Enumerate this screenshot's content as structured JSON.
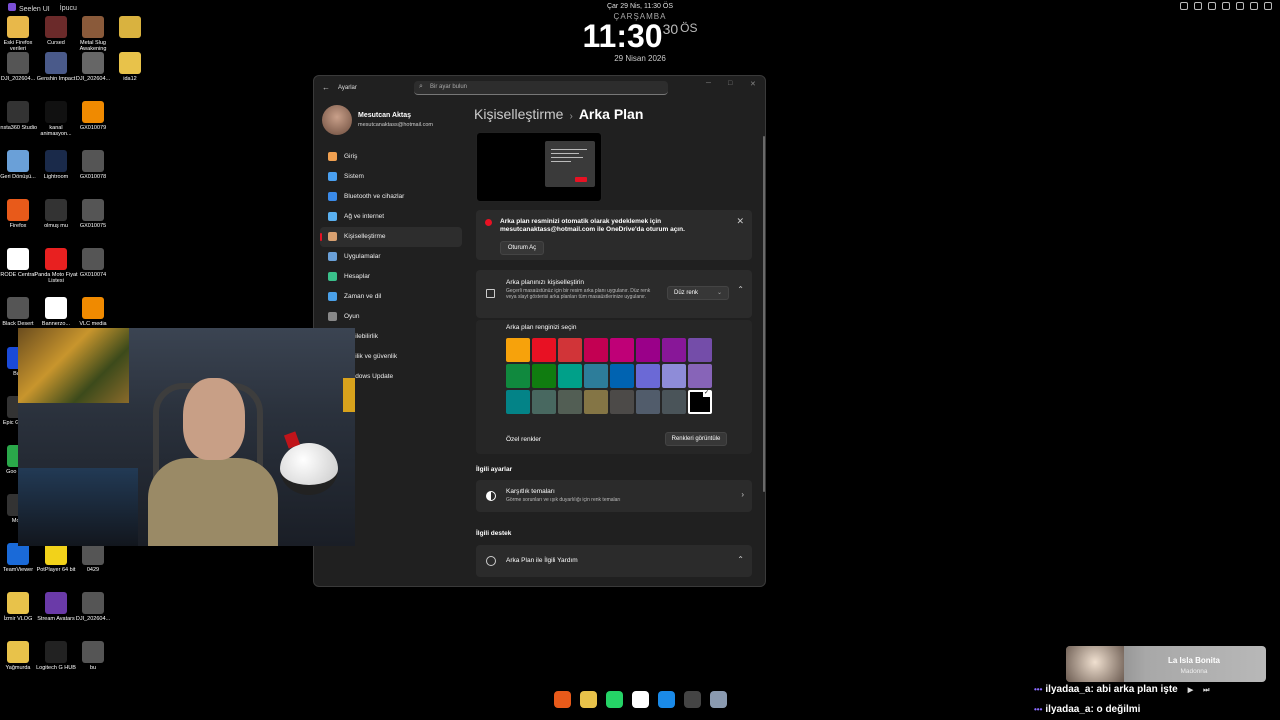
{
  "topbar": {
    "app": "Seelen UI",
    "tip": "İpucu",
    "datetime": "Çar 29 Nis, 11:30 ÖS"
  },
  "clock": {
    "day": "ÇARŞAMBA",
    "time": "11:30",
    "seconds": "30",
    "ampm": "ÖS",
    "date": "29 Nisan 2026"
  },
  "desktop_icons": [
    {
      "label": "Eski Firefox verileri",
      "color": "#e8b84a"
    },
    {
      "label": "Cursed",
      "color": "#6b2a2a"
    },
    {
      "label": "Metal Slug Awakening",
      "color": "#8a5a3a"
    },
    {
      "label": "",
      "color": "#d9b23f"
    },
    {
      "label": "DJI_202604...",
      "color": "#555"
    },
    {
      "label": "Genshin Impact",
      "color": "#4a5a8a"
    },
    {
      "label": "DJI_202604...",
      "color": "#666"
    },
    {
      "label": "ida12",
      "color": "#e8c24a"
    },
    {
      "label": "Insta360 Studio",
      "color": "#333"
    },
    {
      "label": "kanal animasyon...",
      "color": "#111"
    },
    {
      "label": "GX010079",
      "color": "#f08a00"
    },
    {
      "label": "Geri Dönüşü...",
      "color": "#6aa0d8"
    },
    {
      "label": "Lightroom",
      "color": "#1a2a4a"
    },
    {
      "label": "GX010078",
      "color": "#555"
    },
    {
      "label": "Firefox",
      "color": "#e85a1a"
    },
    {
      "label": "olmuş mu",
      "color": "#333"
    },
    {
      "label": "GX010075",
      "color": "#555"
    },
    {
      "label": "RODE Central",
      "color": "#fff"
    },
    {
      "label": "Panda Moto Fiyat Listesi",
      "color": "#e82020"
    },
    {
      "label": "GX010074",
      "color": "#555"
    },
    {
      "label": "Black Desert",
      "color": "#555"
    },
    {
      "label": "Bannerzo...",
      "color": "#fff"
    },
    {
      "label": "VLC media",
      "color": "#f08a00"
    },
    {
      "label": "TeamViewer",
      "color": "#1a6ad8"
    },
    {
      "label": "PotPlayer 64 bit",
      "color": "#f2d21a"
    },
    {
      "label": "0429",
      "color": "#555"
    },
    {
      "label": "İzmir VLOG",
      "color": "#e8c24a"
    },
    {
      "label": "Stream Avatars",
      "color": "#6a3aa8"
    },
    {
      "label": "DJI_202604...",
      "color": "#555"
    },
    {
      "label": "Yağmurda",
      "color": "#e8c24a"
    },
    {
      "label": "Logitech G HUB",
      "color": "#222"
    },
    {
      "label": "bu",
      "color": "#555"
    },
    {
      "label": "Batt",
      "color": "#1a4ad8"
    },
    {
      "label": "Epic G Laun",
      "color": "#333"
    },
    {
      "label": "Goo Chro",
      "color": "#2aa84a"
    },
    {
      "label": "Moto",
      "color": "#333"
    }
  ],
  "settings": {
    "app_title": "Ayarlar",
    "search_placeholder": "Bir ayar bulun",
    "profile": {
      "name": "Mesutcan Aktaş",
      "email": "mesutcanaktass@hotmail.com"
    },
    "nav": [
      {
        "label": "Giriş",
        "color": "#f0a050"
      },
      {
        "label": "Sistem",
        "color": "#4aa0f0"
      },
      {
        "label": "Bluetooth ve cihazlar",
        "color": "#3a8ae8"
      },
      {
        "label": "Ağ ve internet",
        "color": "#5ab0f0"
      },
      {
        "label": "Kişiselleştirme",
        "color": "#d8a070"
      },
      {
        "label": "Uygulamalar",
        "color": "#6aa0d8"
      },
      {
        "label": "Hesaplar",
        "color": "#3ac08a"
      },
      {
        "label": "Zaman ve dil",
        "color": "#4aa0e8"
      },
      {
        "label": "Oyun",
        "color": "#888"
      },
      {
        "label": "Erişilebilirlik",
        "color": "#4a8ae8"
      },
      {
        "label": "Gizlilik ve güvenlik",
        "color": "#888"
      },
      {
        "label": "Windows Update",
        "color": "#3a8ae8"
      }
    ],
    "breadcrumb": {
      "parent": "Kişiselleştirme",
      "separator": "›",
      "current": "Arka Plan"
    },
    "backup": {
      "message": "Arka plan resminizi otomatik olarak yedeklemek için mesutcanaktass@hotmail.com ile OneDrive'da oturum açın.",
      "button": "Oturum Aç"
    },
    "personalize": {
      "title": "Arka planınızı kişiselleştirin",
      "description": "Geçerli masaüstünüz için bir resim arka planı uygulanır. Düz renk veya slayt gösterisi arka planları tüm masaüstlerinize uygulanır.",
      "selected": "Düz renk"
    },
    "color_picker": {
      "label": "Arka plan renginizi seçin",
      "swatches": [
        "#f7a20b",
        "#e81123",
        "#d13438",
        "#c30052",
        "#bf0077",
        "#9a0089",
        "#881798",
        "#744da9",
        "#10893e",
        "#107c10",
        "#00a089",
        "#2d7d9a",
        "#0063b1",
        "#6b69d6",
        "#8e8cd8",
        "#8764b8",
        "#038387",
        "#486860",
        "#525e54",
        "#847545",
        "#4c4a48",
        "#515c6b",
        "#4a5459",
        "#000000"
      ],
      "selected_index": 23,
      "custom_label": "Özel renkler",
      "view_button": "Renkleri görüntüle"
    },
    "related_heading": "İlgili ayarlar",
    "contrast": {
      "title": "Karşıtlık temaları",
      "description": "Görme sorunları ve ışık duyarlılığı için renk temaları"
    },
    "support_heading": "İlgili destek",
    "help": {
      "title": "Arka Plan ile İlgili Yardım"
    }
  },
  "now_playing": {
    "title": "La Isla Bonita",
    "artist": "Madonna"
  },
  "chat": [
    {
      "user": "ilyadaa_a",
      "text": ": abi arka plan işte"
    },
    {
      "user": "ilyadaa_a",
      "text": ": o değilmi"
    }
  ],
  "taskbar": [
    {
      "name": "firefox-icon",
      "color": "#e85a1a"
    },
    {
      "name": "folder-icon",
      "color": "#e8c24a"
    },
    {
      "name": "whatsapp-icon",
      "color": "#25d366"
    },
    {
      "name": "capcut-icon",
      "color": "#fff"
    },
    {
      "name": "store-icon",
      "color": "#1a8ae8"
    },
    {
      "name": "obs-icon",
      "color": "#444"
    },
    {
      "name": "settings-icon",
      "color": "#8a9ab0"
    }
  ]
}
